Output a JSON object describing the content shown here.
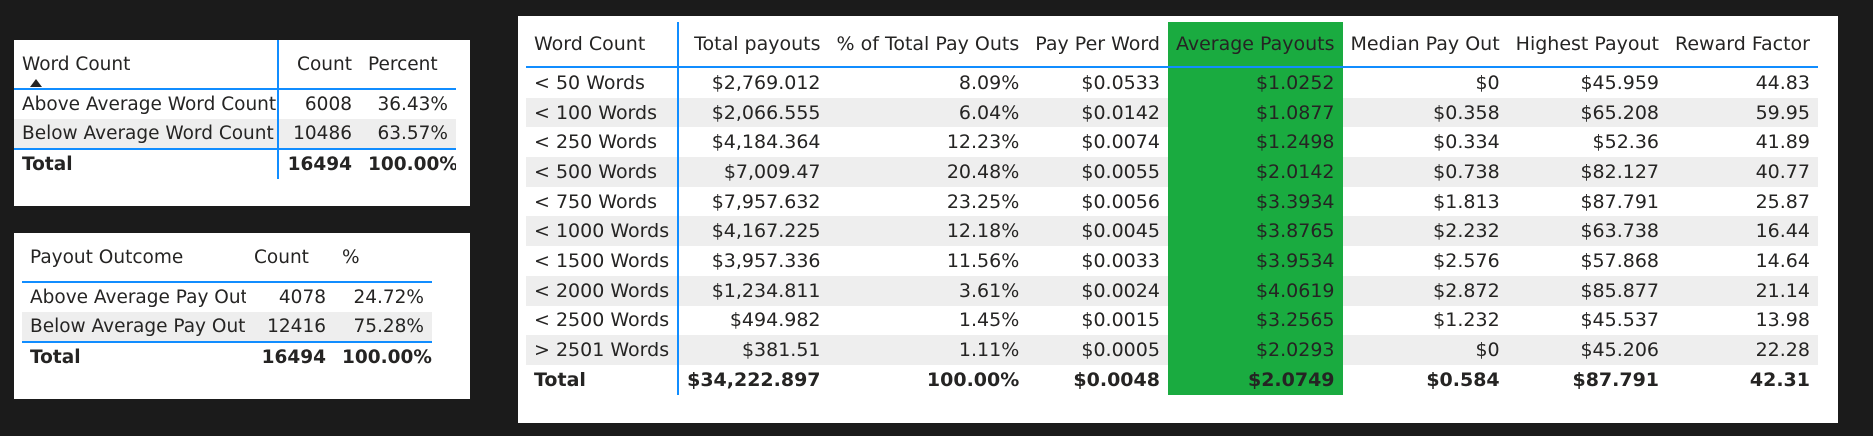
{
  "word_count_table": {
    "headers": [
      "Word Count",
      "Count",
      "Percent"
    ],
    "rows": [
      [
        "Above Average Word Count",
        "6008",
        "36.43%"
      ],
      [
        "Below Average Word Count",
        "10486",
        "63.57%"
      ]
    ],
    "total": [
      "Total",
      "16494",
      "100.00%"
    ]
  },
  "payout_outcome_table": {
    "headers": [
      "Payout Outcome",
      "Count",
      "%"
    ],
    "rows": [
      [
        "Above Average Pay Out",
        "4078",
        "24.72%"
      ],
      [
        "Below Average Pay Out",
        "12416",
        "75.28%"
      ]
    ],
    "total": [
      "Total",
      "16494",
      "100.00%"
    ]
  },
  "main_table": {
    "headers": [
      "Word Count",
      "Total payouts",
      "% of Total Pay Outs",
      "Pay Per Word",
      "Average Payouts",
      "Median Pay Out",
      "Highest Payout",
      "Reward Factor"
    ],
    "rows": [
      [
        "< 50 Words",
        "$2,769.012",
        "8.09%",
        "$0.0533",
        "$1.0252",
        "$0",
        "$45.959",
        "44.83"
      ],
      [
        "< 100 Words",
        "$2,066.555",
        "6.04%",
        "$0.0142",
        "$1.0877",
        "$0.358",
        "$65.208",
        "59.95"
      ],
      [
        "< 250 Words",
        "$4,184.364",
        "12.23%",
        "$0.0074",
        "$1.2498",
        "$0.334",
        "$52.36",
        "41.89"
      ],
      [
        "< 500 Words",
        "$7,009.47",
        "20.48%",
        "$0.0055",
        "$2.0142",
        "$0.738",
        "$82.127",
        "40.77"
      ],
      [
        "< 750 Words",
        "$7,957.632",
        "23.25%",
        "$0.0056",
        "$3.3934",
        "$1.813",
        "$87.791",
        "25.87"
      ],
      [
        "< 1000 Words",
        "$4,167.225",
        "12.18%",
        "$0.0045",
        "$3.8765",
        "$2.232",
        "$63.738",
        "16.44"
      ],
      [
        "< 1500 Words",
        "$3,957.336",
        "11.56%",
        "$0.0033",
        "$3.9534",
        "$2.576",
        "$57.868",
        "14.64"
      ],
      [
        "< 2000 Words",
        "$1,234.811",
        "3.61%",
        "$0.0024",
        "$4.0619",
        "$2.872",
        "$85.877",
        "21.14"
      ],
      [
        "< 2500 Words",
        "$494.982",
        "1.45%",
        "$0.0015",
        "$3.2565",
        "$1.232",
        "$45.537",
        "13.98"
      ],
      [
        "> 2501 Words",
        "$381.51",
        "1.11%",
        "$0.0005",
        "$2.0293",
        "$0",
        "$45.206",
        "22.28"
      ]
    ],
    "total": [
      "Total",
      "$34,222.897",
      "100.00%",
      "$0.0048",
      "$2.0749",
      "$0.584",
      "$87.791",
      "42.31"
    ]
  },
  "colors": {
    "highlight_column": "#1aab40",
    "accent_line": "#118dff",
    "background": "#1b1b1b",
    "alt_row": "#eeeeee"
  }
}
